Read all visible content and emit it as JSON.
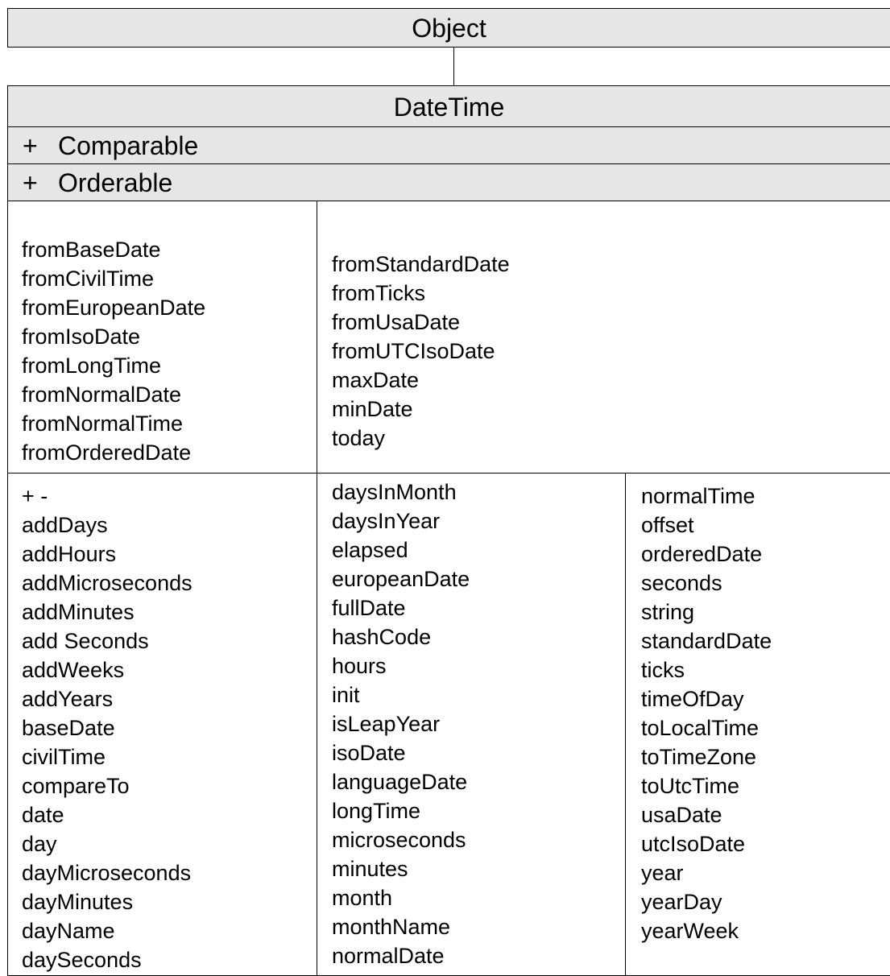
{
  "superclass": {
    "name": "Object"
  },
  "class": {
    "name": "DateTime"
  },
  "interfaces": [
    {
      "prefix": "+",
      "name": "Comparable"
    },
    {
      "prefix": "+",
      "name": "Orderable"
    }
  ],
  "class_members": {
    "column_1": [
      "fromBaseDate",
      "fromCivilTime",
      "fromEuropeanDate",
      "fromIsoDate",
      "fromLongTime",
      "fromNormalDate",
      "fromNormalTime",
      "fromOrderedDate"
    ],
    "column_2": [
      "fromStandardDate",
      "fromTicks",
      "fromUsaDate",
      "fromUTCIsoDate",
      "maxDate",
      "minDate",
      "today"
    ]
  },
  "instance_members": {
    "column_1": [
      "+ -",
      "addDays",
      "addHours",
      "addMicroseconds",
      "addMinutes",
      "add Seconds",
      "addWeeks",
      "addYears",
      "baseDate",
      "civilTime",
      "compareTo",
      "date",
      "day",
      "dayMicroseconds",
      "dayMinutes",
      "dayName",
      "daySeconds"
    ],
    "column_2": [
      "daysInMonth",
      "daysInYear",
      "elapsed",
      "europeanDate",
      "fullDate",
      "hashCode",
      "hours",
      "init",
      "isLeapYear",
      "isoDate",
      "languageDate",
      "longTime",
      "microseconds",
      "minutes",
      "month",
      "monthName",
      "normalDate"
    ],
    "column_3": [
      "normalTime",
      "offset",
      "orderedDate",
      "seconds",
      "string",
      "standardDate",
      "ticks",
      "timeOfDay",
      "toLocalTime",
      "toTimeZone",
      "toUtcTime",
      "usaDate",
      "utcIsoDate",
      "year",
      "yearDay",
      "yearWeek"
    ]
  }
}
